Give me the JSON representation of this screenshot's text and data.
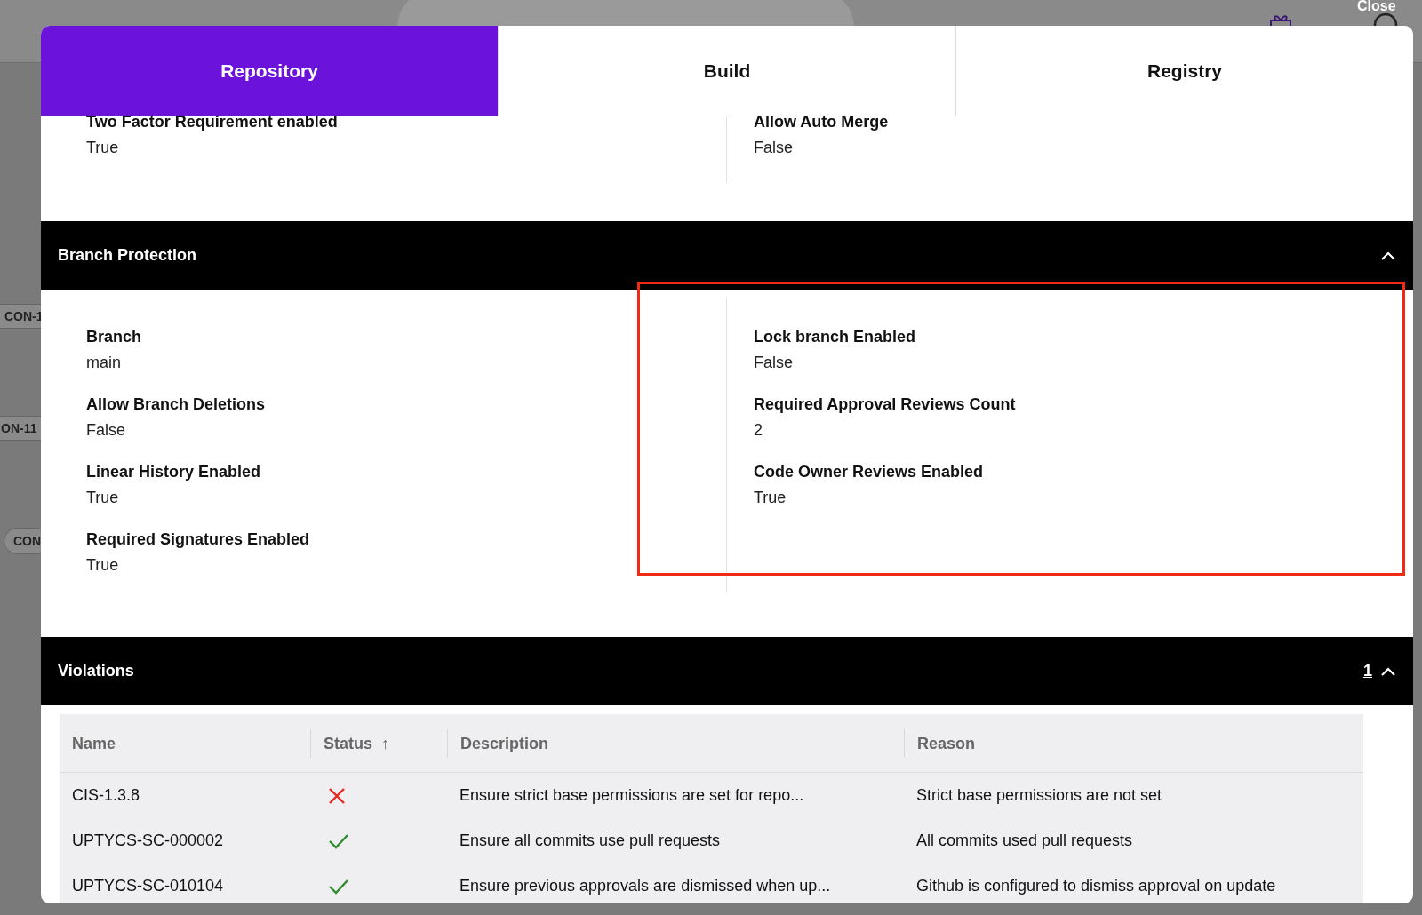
{
  "background": {
    "close_label": "Close",
    "tags": [
      "CON-1",
      "ON-11",
      "CON"
    ]
  },
  "tabs": [
    {
      "label": "Repository",
      "selected": true
    },
    {
      "label": "Build",
      "selected": false
    },
    {
      "label": "Registry",
      "selected": false
    }
  ],
  "top_section": {
    "left": [
      {
        "label": "Two Factor Requirement enabled",
        "value": "True"
      }
    ],
    "right": [
      {
        "label": "Allow Auto Merge",
        "value": "False"
      }
    ]
  },
  "branch_protection": {
    "title": "Branch Protection",
    "expanded": true,
    "left": [
      {
        "label": "Branch",
        "value": "main"
      },
      {
        "label": "Allow Branch Deletions",
        "value": "False"
      },
      {
        "label": "Linear History Enabled",
        "value": "True"
      },
      {
        "label": "Required Signatures Enabled",
        "value": "True"
      }
    ],
    "right": [
      {
        "label": "Lock branch Enabled",
        "value": "False"
      },
      {
        "label": "Required Approval Reviews Count",
        "value": "2"
      },
      {
        "label": "Code Owner Reviews Enabled",
        "value": "True"
      }
    ],
    "highlighted": true
  },
  "violations": {
    "title": "Violations",
    "count": "1",
    "expanded": true,
    "columns": [
      {
        "label": "Name"
      },
      {
        "label": "Status",
        "sort": "↑"
      },
      {
        "label": "Description"
      },
      {
        "label": "Reason"
      }
    ],
    "rows": [
      {
        "name": "CIS-1.3.8",
        "passed": false,
        "description": "Ensure strict base permissions are set for repo...",
        "reason": "Strict base permissions are not set"
      },
      {
        "name": "UPTYCS-SC-000002",
        "passed": true,
        "description": "Ensure all commits use pull requests",
        "reason": "All commits used pull requests"
      },
      {
        "name": "UPTYCS-SC-010104",
        "passed": true,
        "description": "Ensure previous approvals are dismissed when up...",
        "reason": "Github is configured to dismiss approval on update"
      }
    ]
  }
}
